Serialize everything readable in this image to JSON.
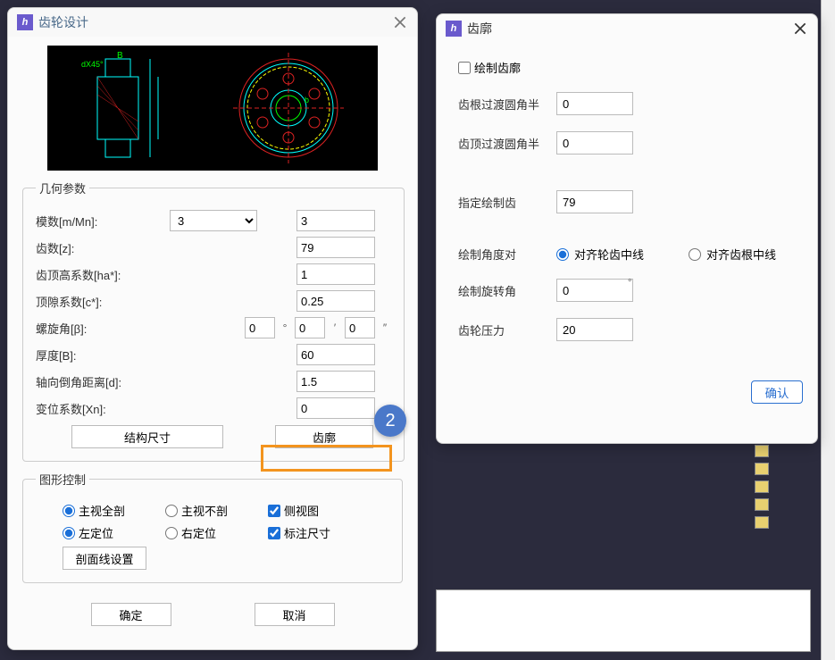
{
  "dialog_left": {
    "title": "齿轮设计",
    "geom_legend": "几何参数",
    "module_label": "模数[m/Mn]:",
    "module_sel": "3",
    "module_val": "3",
    "teeth_label": "齿数[z]:",
    "teeth_val": "79",
    "addendum_label": "齿顶高系数[ha*]:",
    "addendum_val": "1",
    "clearance_label": "顶隙系数[c*]:",
    "clearance_val": "0.25",
    "helix_label": "螺旋角[β]:",
    "helix_d": "0",
    "helix_m": "0",
    "helix_s": "0",
    "deg_sym": "°",
    "min_sym": "′",
    "sec_sym": "″",
    "thickness_label": "厚度[B]:",
    "thickness_val": "60",
    "chamfer_label": "轴向倒角距离[d]:",
    "chamfer_val": "1.5",
    "shift_label": "变位系数[Xn]:",
    "shift_val": "0",
    "struct_btn": "结构尺寸",
    "profile_btn": "齿廓",
    "graphics_legend": "图形控制",
    "main_full": "主视全剖",
    "main_none": "主视不剖",
    "side_view": "侧视图",
    "left_pos": "左定位",
    "right_pos": "右定位",
    "dim_label": "标注尺寸",
    "hatch_btn": "剖面线设置",
    "ok_btn": "确定",
    "cancel_btn": "取消",
    "marker": "2"
  },
  "dialog_right": {
    "title": "齿廓",
    "draw_profile": "绘制齿廓",
    "root_fillet": "齿根过渡圆角半",
    "root_val": "0",
    "tip_fillet": "齿顶过渡圆角半",
    "tip_val": "0",
    "spec_teeth": "指定绘制齿",
    "spec_val": "79",
    "angle_align": "绘制角度对",
    "align_mid": "对齐轮齿中线",
    "align_root": "对齐齿根中线",
    "rot_angle": "绘制旋转角",
    "rot_val": "0",
    "pressure": "齿轮压力",
    "pressure_val": "20",
    "ok": "确认"
  }
}
